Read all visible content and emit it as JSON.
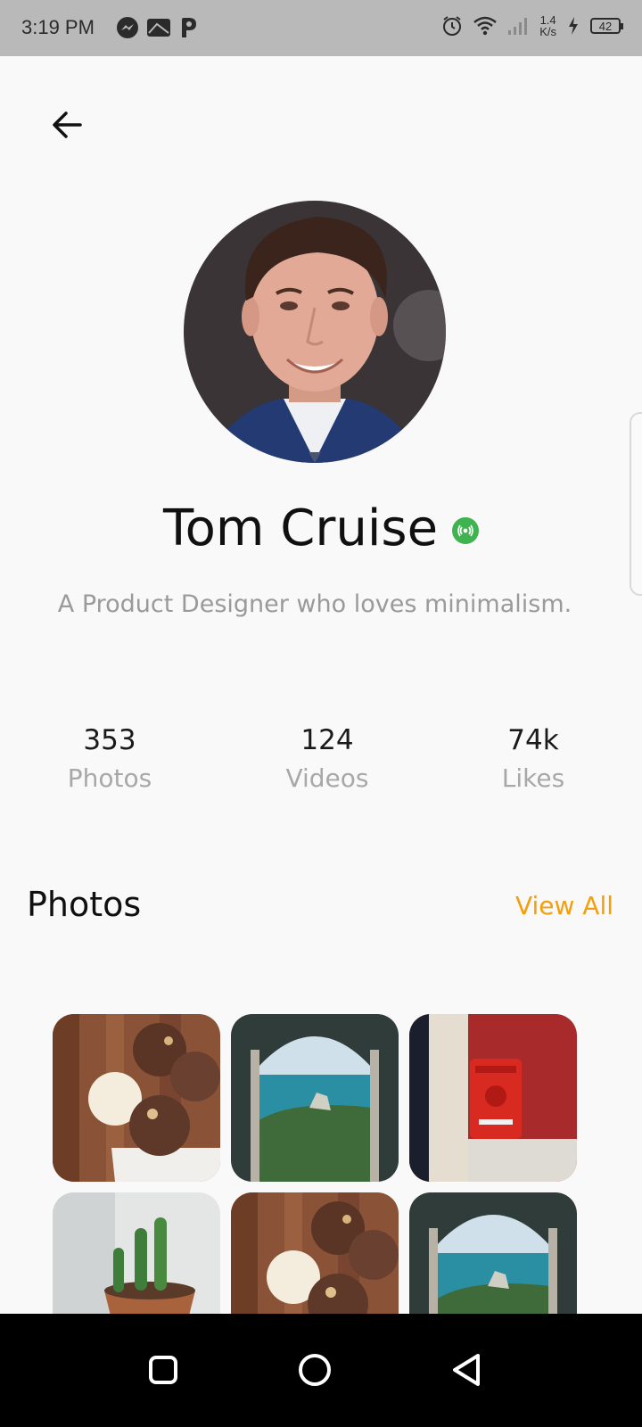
{
  "status_bar": {
    "time": "3:19 PM",
    "left_icons": [
      "messenger-icon",
      "inbox-icon",
      "parking-icon"
    ],
    "right_icons": [
      "alarm-icon",
      "wifi-icon",
      "signal-icon",
      "charging-icon"
    ],
    "net_speed_value": "1.4",
    "net_speed_unit": "K/s",
    "battery": "42"
  },
  "profile": {
    "name": "Tom Cruise",
    "bio": "A Product Designer who loves minimalism.",
    "live_badge_color": "#3fb34f"
  },
  "stats": [
    {
      "value": "353",
      "label": "Photos"
    },
    {
      "value": "124",
      "label": "Videos"
    },
    {
      "value": "74k",
      "label": "Likes"
    }
  ],
  "photos_section": {
    "title": "Photos",
    "view_all": "View All",
    "accent_color": "#f59e0b",
    "items": [
      "ice-cream-cones",
      "sea-arch-view",
      "red-mailbox",
      "potted-cactus",
      "ice-cream-cones",
      "sea-arch-view"
    ]
  },
  "nav_bar": {
    "buttons": [
      "recents-square-icon",
      "home-circle-icon",
      "back-triangle-icon"
    ]
  }
}
